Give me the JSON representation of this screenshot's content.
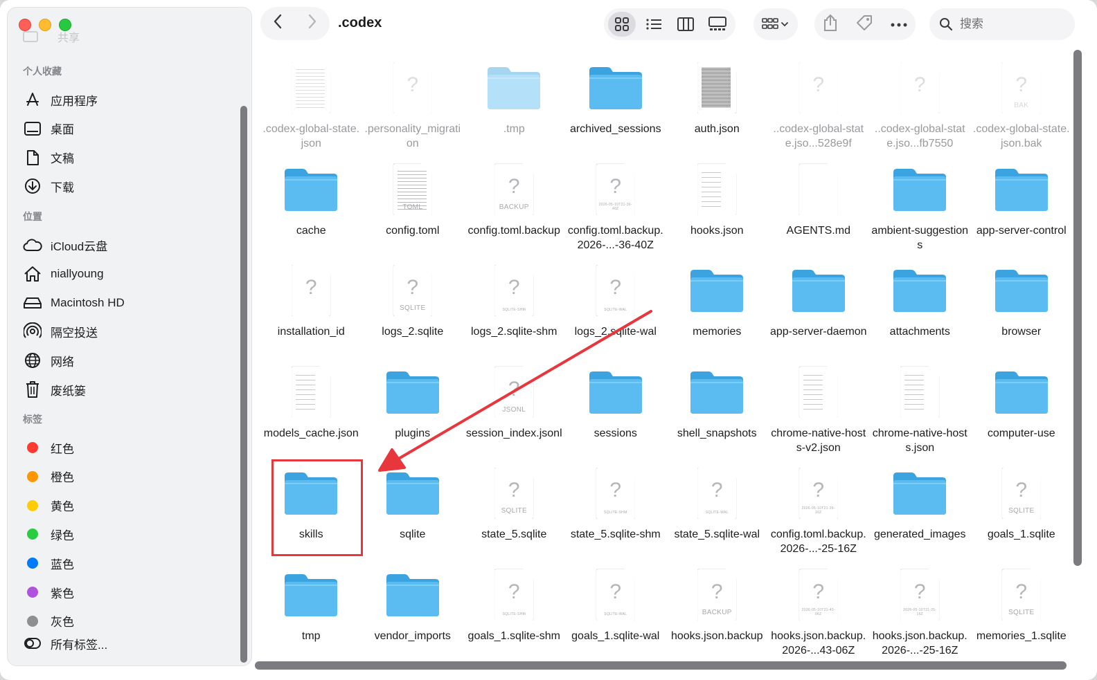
{
  "sidebar": {
    "shared_label": "共享",
    "favorites_title": "个人收藏",
    "favorites": [
      {
        "label": "应用程序",
        "icon": "apps-icon"
      },
      {
        "label": "桌面",
        "icon": "desktop-icon"
      },
      {
        "label": "文稿",
        "icon": "document-icon"
      },
      {
        "label": "下载",
        "icon": "download-icon"
      }
    ],
    "locations_title": "位置",
    "locations": [
      {
        "label": "iCloud云盘",
        "icon": "cloud-icon"
      },
      {
        "label": "niallyoung",
        "icon": "home-icon"
      },
      {
        "label": "Macintosh HD",
        "icon": "disk-icon"
      },
      {
        "label": "隔空投送",
        "icon": "airdrop-icon"
      },
      {
        "label": "网络",
        "icon": "globe-icon"
      },
      {
        "label": "废纸篓",
        "icon": "trash-icon"
      }
    ],
    "tags_title": "标签",
    "tags": [
      {
        "label": "红色",
        "color": "#ff3b30"
      },
      {
        "label": "橙色",
        "color": "#ff9500"
      },
      {
        "label": "黄色",
        "color": "#ffcc00"
      },
      {
        "label": "绿色",
        "color": "#28cd41"
      },
      {
        "label": "蓝色",
        "color": "#007aff"
      },
      {
        "label": "紫色",
        "color": "#af52de"
      },
      {
        "label": "灰色",
        "color": "#8e8e93"
      }
    ],
    "all_tags_label": "所有标签..."
  },
  "toolbar": {
    "title": ".codex",
    "search_placeholder": "搜索"
  },
  "files": [
    {
      "name": ".codex-global-state.json",
      "kind": "doc-text",
      "dim": true
    },
    {
      "name": ".personality_migration",
      "kind": "doc-unknown",
      "dim": true
    },
    {
      "name": ".tmp",
      "kind": "folder",
      "dim": true
    },
    {
      "name": "archived_sessions",
      "kind": "folder"
    },
    {
      "name": "auth.json",
      "kind": "doc-dense"
    },
    {
      "name": "..codex-global-state.jso...528e9f",
      "kind": "doc-unknown",
      "dim": true
    },
    {
      "name": "..codex-global-state.jso...fb7550",
      "kind": "doc-unknown",
      "dim": true
    },
    {
      "name": ".codex-global-state.json.bak",
      "kind": "doc-unknown",
      "ext": "BAK",
      "dim": true
    },
    {
      "name": "cache",
      "kind": "folder"
    },
    {
      "name": "config.toml",
      "kind": "doc-text",
      "ext": "TOML"
    },
    {
      "name": "config.toml.backup",
      "kind": "doc-unknown",
      "ext": "BACKUP"
    },
    {
      "name": "config.toml.backup.2026-...-36-40Z",
      "kind": "doc-unknown",
      "ext": "2026-05-10T21-36-40Z",
      "tiny": true
    },
    {
      "name": "hooks.json",
      "kind": "doc-sparse"
    },
    {
      "name": "AGENTS.md",
      "kind": "doc-blank"
    },
    {
      "name": "ambient-suggestions",
      "kind": "folder"
    },
    {
      "name": "app-server-control",
      "kind": "folder"
    },
    {
      "name": "installation_id",
      "kind": "doc-unknown"
    },
    {
      "name": "logs_2.sqlite",
      "kind": "doc-unknown",
      "ext": "SQLITE"
    },
    {
      "name": "logs_2.sqlite-shm",
      "kind": "doc-unknown",
      "ext": "SQLITE-SHM",
      "tiny": true
    },
    {
      "name": "logs_2.sqlite-wal",
      "kind": "doc-unknown",
      "ext": "SQLITE-WAL",
      "tiny": true
    },
    {
      "name": "memories",
      "kind": "folder"
    },
    {
      "name": "app-server-daemon",
      "kind": "folder"
    },
    {
      "name": "attachments",
      "kind": "folder"
    },
    {
      "name": "browser",
      "kind": "folder"
    },
    {
      "name": "models_cache.json",
      "kind": "doc-sparse"
    },
    {
      "name": "plugins",
      "kind": "folder"
    },
    {
      "name": "session_index.jsonl",
      "kind": "doc-unknown",
      "ext": "JSONL"
    },
    {
      "name": "sessions",
      "kind": "folder"
    },
    {
      "name": "shell_snapshots",
      "kind": "folder"
    },
    {
      "name": "chrome-native-hosts-v2.json",
      "kind": "doc-sparse"
    },
    {
      "name": "chrome-native-hosts.json",
      "kind": "doc-sparse"
    },
    {
      "name": "computer-use",
      "kind": "folder"
    },
    {
      "name": "skills",
      "kind": "folder"
    },
    {
      "name": "sqlite",
      "kind": "folder"
    },
    {
      "name": "state_5.sqlite",
      "kind": "doc-unknown",
      "ext": "SQLITE"
    },
    {
      "name": "state_5.sqlite-shm",
      "kind": "doc-unknown",
      "ext": "SQLITE-SHM",
      "tiny": true
    },
    {
      "name": "state_5.sqlite-wal",
      "kind": "doc-unknown",
      "ext": "SQLITE-WAL",
      "tiny": true
    },
    {
      "name": "config.toml.backup.2026-...-25-16Z",
      "kind": "doc-unknown",
      "ext": "2026-05-10T21-25-16Z",
      "tiny": true
    },
    {
      "name": "generated_images",
      "kind": "folder"
    },
    {
      "name": "goals_1.sqlite",
      "kind": "doc-unknown",
      "ext": "SQLITE"
    },
    {
      "name": "tmp",
      "kind": "folder"
    },
    {
      "name": "vendor_imports",
      "kind": "folder"
    },
    {
      "name": "goals_1.sqlite-shm",
      "kind": "doc-unknown",
      "ext": "SQLITE-SHM",
      "tiny": true
    },
    {
      "name": "goals_1.sqlite-wal",
      "kind": "doc-unknown",
      "ext": "SQLITE-WAL",
      "tiny": true
    },
    {
      "name": "hooks.json.backup",
      "kind": "doc-unknown",
      "ext": "BACKUP"
    },
    {
      "name": "hooks.json.backup.2026-...43-06Z",
      "kind": "doc-unknown",
      "ext": "2026-05-10T21-43-06Z",
      "tiny": true
    },
    {
      "name": "hooks.json.backup.2026-...-25-16Z",
      "kind": "doc-unknown",
      "ext": "2026-05-10T21-25-16Z",
      "tiny": true
    },
    {
      "name": "memories_1.sqlite",
      "kind": "doc-unknown",
      "ext": "SQLITE"
    }
  ],
  "annotation": {
    "highlight_color": "#e8363d"
  }
}
